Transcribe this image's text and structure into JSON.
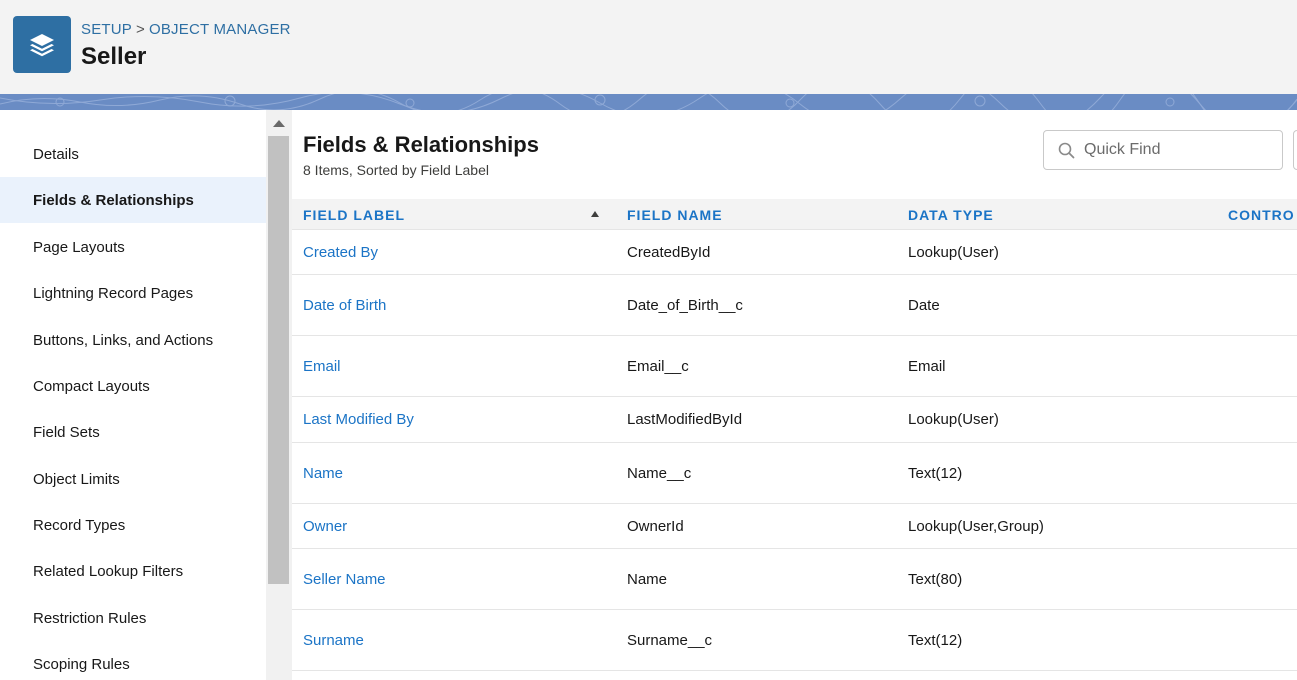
{
  "header": {
    "breadcrumb": [
      "SETUP",
      "OBJECT MANAGER"
    ],
    "breadcrumb_separator": ">",
    "object_name": "Seller",
    "icon": "layers-icon"
  },
  "sidebar": {
    "items": [
      {
        "label": "Details",
        "active": false
      },
      {
        "label": "Fields & Relationships",
        "active": true
      },
      {
        "label": "Page Layouts",
        "active": false
      },
      {
        "label": "Lightning Record Pages",
        "active": false
      },
      {
        "label": "Buttons, Links, and Actions",
        "active": false
      },
      {
        "label": "Compact Layouts",
        "active": false
      },
      {
        "label": "Field Sets",
        "active": false
      },
      {
        "label": "Object Limits",
        "active": false
      },
      {
        "label": "Record Types",
        "active": false
      },
      {
        "label": "Related Lookup Filters",
        "active": false
      },
      {
        "label": "Restriction Rules",
        "active": false
      },
      {
        "label": "Scoping Rules",
        "active": false
      }
    ]
  },
  "main": {
    "title": "Fields & Relationships",
    "subtitle": "8 Items, Sorted by Field Label",
    "quick_find_placeholder": "Quick Find",
    "columns": [
      "FIELD LABEL",
      "FIELD NAME",
      "DATA TYPE",
      "CONTRO"
    ],
    "sort_column": "FIELD LABEL",
    "sort_direction": "ascending",
    "rows": [
      {
        "label": "Created By",
        "name": "CreatedById",
        "type": "Lookup(User)"
      },
      {
        "label": "Date of Birth",
        "name": "Date_of_Birth__c",
        "type": "Date"
      },
      {
        "label": "Email",
        "name": "Email__c",
        "type": "Email"
      },
      {
        "label": "Last Modified By",
        "name": "LastModifiedById",
        "type": "Lookup(User)"
      },
      {
        "label": "Name",
        "name": "Name__c",
        "type": "Text(12)"
      },
      {
        "label": "Owner",
        "name": "OwnerId",
        "type": "Lookup(User,Group)"
      },
      {
        "label": "Seller Name",
        "name": "Name",
        "type": "Text(80)"
      },
      {
        "label": "Surname",
        "name": "Surname__c",
        "type": "Text(12)"
      }
    ]
  },
  "colors": {
    "brand_blue": "#2e6fa3",
    "link_blue": "#1b74c6",
    "band_blue": "#6a8cc4",
    "active_nav_bg": "#eaf2fc"
  }
}
